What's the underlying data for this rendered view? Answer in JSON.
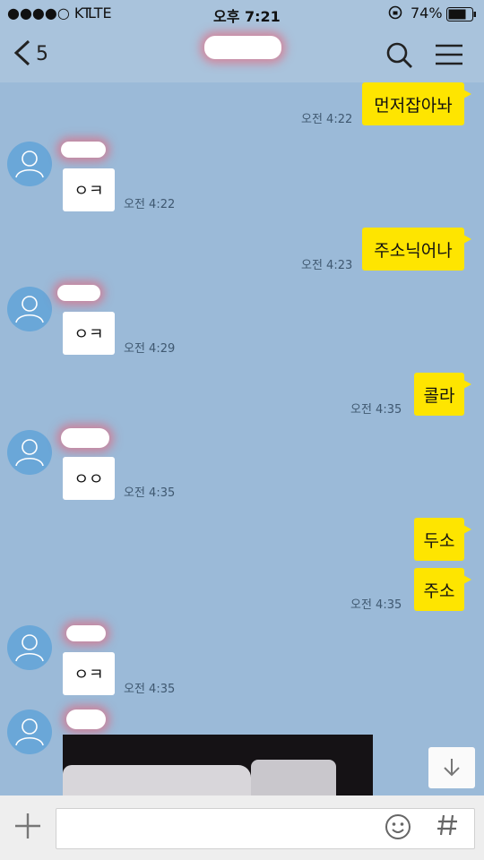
{
  "status_bar": {
    "carrier": "●●●●○ KT",
    "network": "LTE",
    "time": "오후 7:21",
    "battery": "74%"
  },
  "header": {
    "back_count": "5"
  },
  "messages": [
    {
      "dir": "out",
      "text": "먼저잡아놔",
      "time": "오전 4:22"
    },
    {
      "dir": "in",
      "text": "ㅇㅋ",
      "time": "오전 4:22"
    },
    {
      "dir": "out",
      "text": "주소닉어나",
      "time": "오전 4:23"
    },
    {
      "dir": "in",
      "text": "ㅇㅋ",
      "time": "오전 4:29"
    },
    {
      "dir": "out",
      "text": "콜라",
      "time": "오전 4:35"
    },
    {
      "dir": "in",
      "text": "ㅇㅇ",
      "time": "오전 4:35"
    },
    {
      "dir": "out",
      "text": "두소",
      "time": ""
    },
    {
      "dir": "out",
      "text": "주소",
      "time": "오전 4:35"
    },
    {
      "dir": "in",
      "text": "ㅇㅋ",
      "time": "오전 4:35"
    }
  ],
  "colors": {
    "chat_bg": "#9bbad8",
    "my_bubble": "#fee500",
    "their_bubble": "#ffffff"
  }
}
